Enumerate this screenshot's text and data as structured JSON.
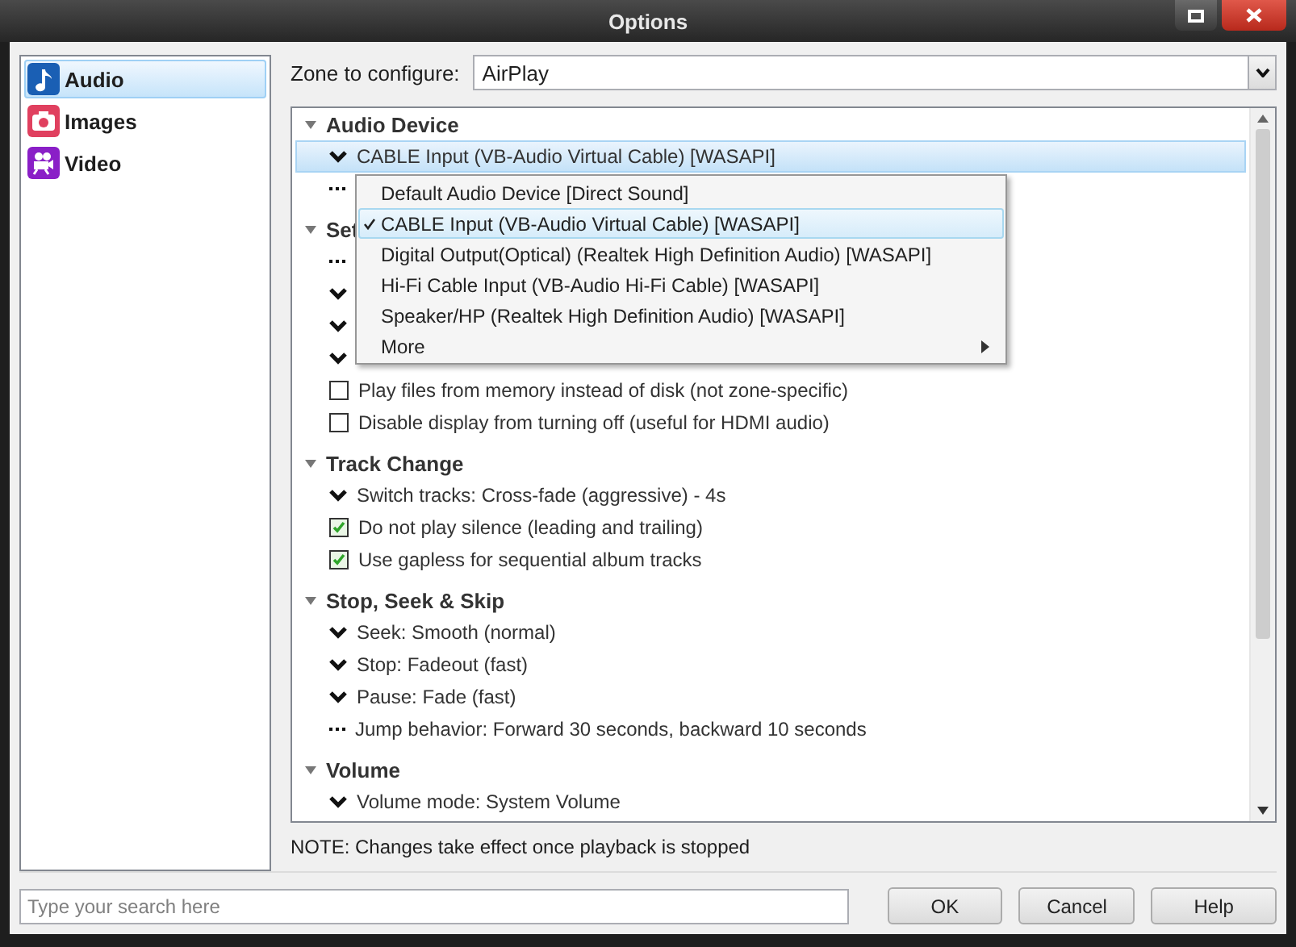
{
  "window": {
    "title": "Options"
  },
  "sidebar": {
    "items": [
      {
        "label": "Audio",
        "selected": true
      },
      {
        "label": "Images",
        "selected": false
      },
      {
        "label": "Video",
        "selected": false
      }
    ]
  },
  "zone": {
    "label": "Zone to configure:",
    "value": "AirPlay"
  },
  "tree": {
    "sections": [
      {
        "title": "Audio Device",
        "expanded": true,
        "rows": [
          {
            "kind": "dropdown",
            "label": "CABLE Input (VB-Audio Virtual Cable) [WASAPI]",
            "selected": true
          },
          {
            "kind": "more",
            "selected": false
          }
        ]
      },
      {
        "title": "Set",
        "expanded": true,
        "rows": [
          {
            "kind": "more",
            "selected": false
          },
          {
            "kind": "dropdown",
            "selected": false
          },
          {
            "kind": "dropdown",
            "selected": false
          },
          {
            "kind": "dropdown",
            "selected": false
          },
          {
            "kind": "checkbox",
            "label": "Play files from memory instead of disk (not zone-specific)",
            "checked": false,
            "selected": false
          },
          {
            "kind": "checkbox",
            "label": "Disable display from turning off (useful for HDMI audio)",
            "checked": false,
            "selected": false
          }
        ]
      },
      {
        "title": "Track Change",
        "expanded": true,
        "rows": [
          {
            "kind": "dropdown",
            "label": "Switch tracks: Cross-fade (aggressive) - 4s",
            "selected": false
          },
          {
            "kind": "checkbox",
            "label": "Do not play silence (leading and trailing)",
            "checked": true,
            "selected": false
          },
          {
            "kind": "checkbox",
            "label": "Use gapless for sequential album tracks",
            "checked": true,
            "selected": false
          }
        ]
      },
      {
        "title": "Stop, Seek & Skip",
        "expanded": true,
        "rows": [
          {
            "kind": "dropdown",
            "label": "Seek: Smooth (normal)",
            "selected": false
          },
          {
            "kind": "dropdown",
            "label": "Stop: Fadeout (fast)",
            "selected": false
          },
          {
            "kind": "dropdown",
            "label": "Pause: Fade (fast)",
            "selected": false
          },
          {
            "kind": "more",
            "label": "Jump behavior: Forward 30 seconds, backward 10 seconds",
            "selected": false
          }
        ]
      },
      {
        "title": "Volume",
        "expanded": true,
        "rows": [
          {
            "kind": "dropdown",
            "label": "Volume mode: System Volume",
            "selected": false
          }
        ]
      }
    ]
  },
  "menu": {
    "items": [
      {
        "kind": "item",
        "label": "Default Audio Device [Direct Sound]",
        "checked": false,
        "selected": false
      },
      {
        "kind": "item",
        "label": "CABLE Input (VB-Audio Virtual Cable) [WASAPI]",
        "checked": true,
        "selected": true
      },
      {
        "kind": "item",
        "label": "Digital Output(Optical) (Realtek High Definition Audio) [WASAPI]",
        "checked": false,
        "selected": false
      },
      {
        "kind": "item",
        "label": "Hi-Fi Cable Input (VB-Audio Hi-Fi Cable) [WASAPI]",
        "checked": false,
        "selected": false
      },
      {
        "kind": "item",
        "label": "Speaker/HP (Realtek High Definition Audio) [WASAPI]",
        "checked": false,
        "selected": false
      },
      {
        "kind": "submenu",
        "label": "More",
        "checked": false,
        "selected": false
      }
    ]
  },
  "note": "NOTE: Changes take effect once playback is stopped",
  "search": {
    "placeholder": "Type your search here"
  },
  "buttons": [
    "OK",
    "Cancel",
    "Help"
  ]
}
